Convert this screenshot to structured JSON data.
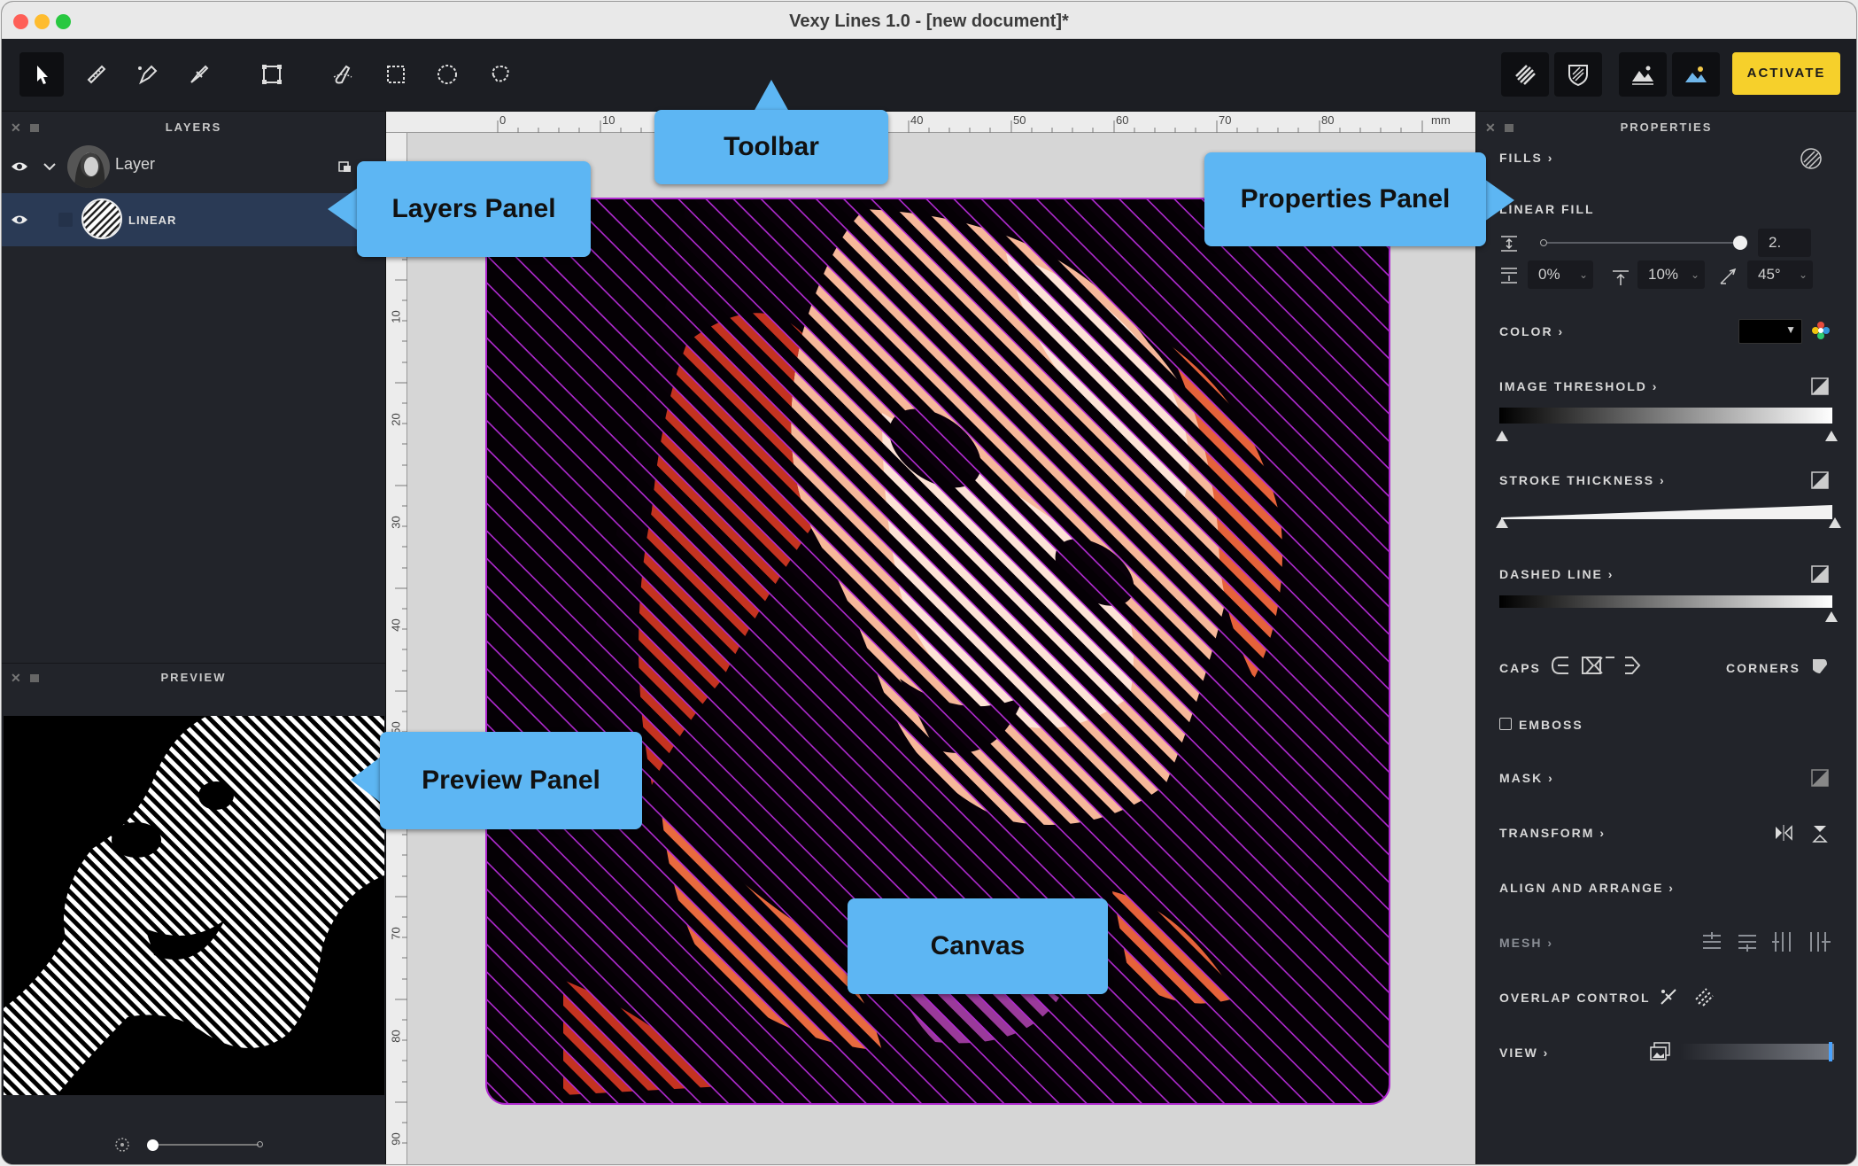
{
  "window": {
    "title": "Vexy Lines 1.0 - [new document]*"
  },
  "toolbar": {
    "tools": [
      "arrow-select-tool",
      "ruler-tool",
      "pen-tool",
      "pen-edit-tool",
      "transform-tool",
      "brush-tool",
      "rect-select-tool",
      "ellipse-select-tool",
      "lasso-select-tool"
    ],
    "activate_label": "ACTIVATE"
  },
  "layers": {
    "header": "LAYERS",
    "layer_name": "Layer",
    "fill_name": "LINEAR"
  },
  "preview": {
    "header": "PREVIEW"
  },
  "ruler": {
    "top": [
      "0",
      "10",
      "40",
      "50",
      "60",
      "70",
      "80",
      "mm"
    ],
    "left": [
      "10",
      "20",
      "30",
      "40",
      "50",
      "70",
      "80",
      "90"
    ]
  },
  "properties": {
    "header": "PROPERTIES",
    "fills": "FILLS",
    "linear_fill": "LINEAR FILL",
    "spacing_value": "2.",
    "offset_value": "0%",
    "smooth_value": "10%",
    "angle_value": "45°",
    "color": "COLOR",
    "image_threshold": "IMAGE THRESHOLD",
    "stroke_thickness": "STROKE THICKNESS",
    "dashed_line": "DASHED LINE",
    "caps": "CAPS",
    "corners": "CORNERS",
    "emboss": "EMBOSS",
    "mask": "MASK",
    "transform": "TRANSFORM",
    "align_arrange": "ALIGN AND ARRANGE",
    "mesh": "MESH",
    "overlap_control": "OVERLAP CONTROL",
    "view": "VIEW"
  },
  "callouts": {
    "toolbar": "Toolbar",
    "layers_panel": "Layers Panel",
    "properties_panel": "Properties Panel",
    "preview_panel": "Preview Panel",
    "canvas": "Canvas"
  },
  "colors": {
    "accent_yellow": "#f6d02b",
    "callout_blue": "#5db6f3",
    "panel_bg": "#22242a",
    "selection_blue": "#2a3a55"
  }
}
